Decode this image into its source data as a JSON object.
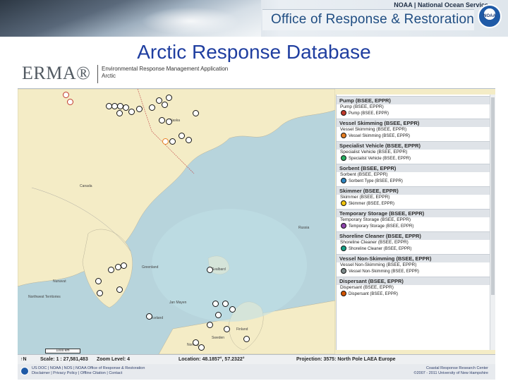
{
  "banner": {
    "agency": "NOAA | National Ocean Service",
    "office": "Office of Response & Restoration",
    "logo_text": "NOAA"
  },
  "slide_title": "Arctic Response Database",
  "erma": {
    "logo": "ERMA®",
    "subtitle_line1": "Environmental Response Management Application",
    "subtitle_line2": "Arctic"
  },
  "map_labels": {
    "alaska": "Alaska",
    "canada": "Canada",
    "greenland": "Greenland",
    "iceland": "Iceland",
    "russia": "Russia",
    "finland": "Finland",
    "sweden": "Sweden",
    "norway": "Norway",
    "jan_mayen": "Jan Mayen",
    "svalbard": "Svalbard",
    "nunavut": "Nunavut",
    "nwt": "Northwest Territories"
  },
  "legend": {
    "groups": [
      {
        "header": "Pump (BSEE, EPPR)",
        "line": "Pump (BSEE, EPPR)",
        "item": "Pump (BSEE, EPPR)",
        "color": "#c0392b"
      },
      {
        "header": "Vessel Skimming (BSEE, EPPR)",
        "line": "Vessel Skimming (BSEE, EPPR)",
        "item": "Vessel Skimming (BSEE, EPPR)",
        "color": "#e67e22"
      },
      {
        "header": "Specialist Vehicle (BSEE, EPPR)",
        "line": "Specialist Vehicle (BSEE, EPPR)",
        "item": "Specialist Vehicle (BSEE, EPPR)",
        "color": "#27ae60"
      },
      {
        "header": "Sorbent (BSEE, EPPR)",
        "line": "Sorbent (BSEE, EPPR)",
        "item": "Sorbent Type (BSEE, EPPR)",
        "color": "#2e86c1"
      },
      {
        "header": "Skimmer (BSEE, EPPR)",
        "line": "Skimmer (BSEE, EPPR)",
        "item": "Skimmer (BSEE, EPPR)",
        "color": "#f1c40f"
      },
      {
        "header": "Temporary Storage (BSEE, EPPR)",
        "line": "Temporary Storage (BSEE, EPPR)",
        "item": "Temporary Storage (BSEE, EPPR)",
        "color": "#8e44ad"
      },
      {
        "header": "Shoreline Cleaner (BSEE, EPPR)",
        "line": "Shoreline Cleaner (BSEE, EPPR)",
        "item": "Shoreline Cleaner (BSEE, EPPR)",
        "color": "#16a085"
      },
      {
        "header": "Vessel Non-Skimming (BSEE, EPPR)",
        "line": "Vessel Non-Skimming (BSEE, EPPR)",
        "item": "Vessel Non-Skimming (BSEE, EPPR)",
        "color": "#7f8c8d"
      },
      {
        "header": "Dispersant (BSEE, EPPR)",
        "line": "Dispersant (BSEE, EPPR)",
        "item": "Dispersant (BSEE, EPPR)",
        "color": "#d35400"
      }
    ]
  },
  "status": {
    "north": "↑N",
    "scale": "Scale: 1 : 27,581,483",
    "zoom": "Zoom Level: 4",
    "location": "Location: 48.1857°, 57.2322°",
    "projection": "Projection: 3575: North Pole LAEA Europe",
    "scalebar": "1000 km"
  },
  "footer": {
    "left1": "US DOC | NOAA | NOS | NOAA Office of Response & Restoration",
    "left2": "Disclaimer | Privacy Policy | Offline Citation | Contact",
    "right1": "Coastal Response Research Center",
    "right2": "©2007 - 2011 University of New Hampshire"
  }
}
